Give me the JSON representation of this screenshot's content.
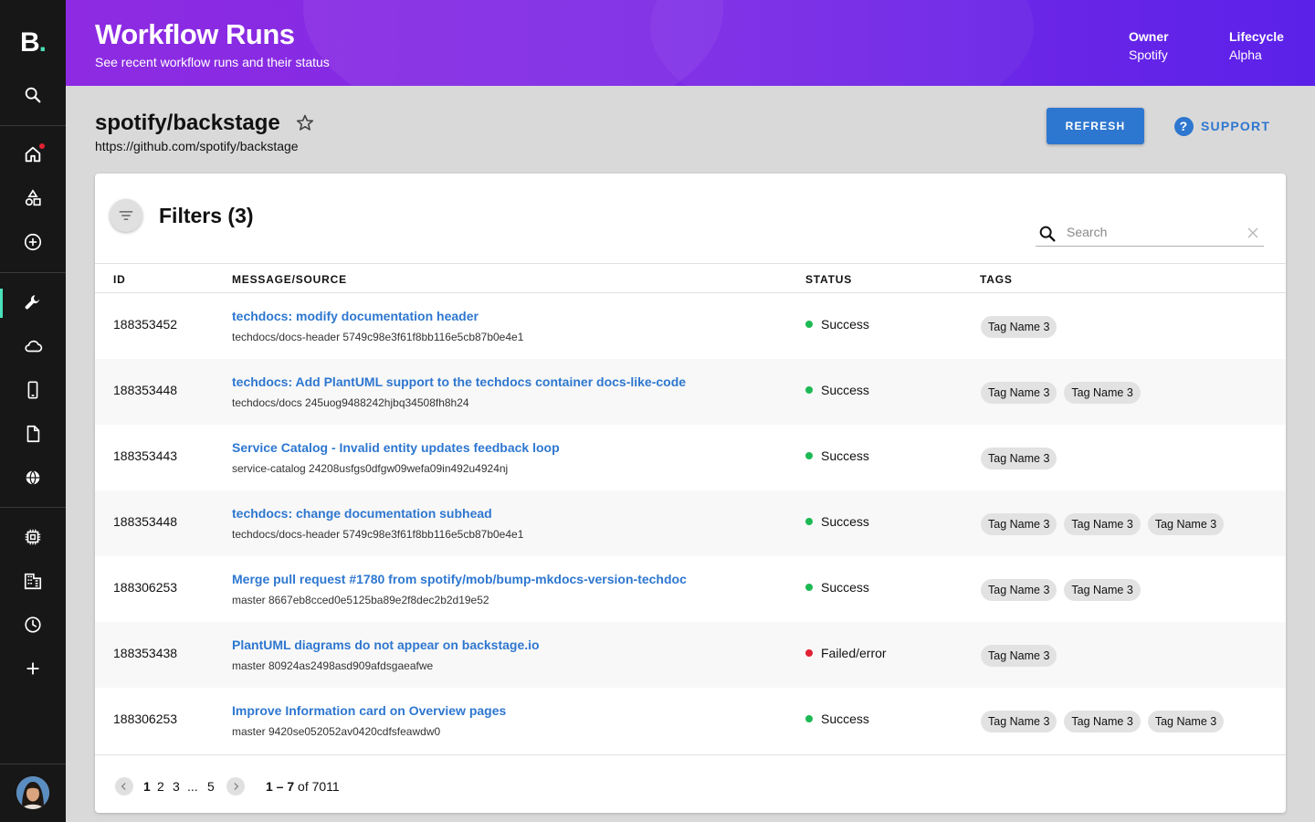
{
  "sidebar": {
    "logo_letter": "B",
    "logo_dot": ".",
    "items": [
      {
        "name": "search-icon"
      },
      {
        "name": "home-icon"
      },
      {
        "name": "catalog-icon"
      },
      {
        "name": "create-icon"
      },
      {
        "name": "tools-icon"
      },
      {
        "name": "cloud-icon"
      },
      {
        "name": "mobile-icon"
      },
      {
        "name": "docs-icon"
      },
      {
        "name": "globe-icon"
      },
      {
        "name": "chip-icon"
      },
      {
        "name": "building-icon"
      },
      {
        "name": "history-icon"
      },
      {
        "name": "add-icon"
      }
    ],
    "accent_color": "#49e0ba"
  },
  "header": {
    "title": "Workflow Runs",
    "subtitle": "See recent workflow runs and their status",
    "owner_label": "Owner",
    "owner_value": "Spotify",
    "lifecycle_label": "Lifecycle",
    "lifecycle_value": "Alpha"
  },
  "repo": {
    "title": "spotify/backstage",
    "url": "https://github.com/spotify/backstage"
  },
  "actions": {
    "refresh_label": "REFRESH",
    "support_label": "SUPPORT",
    "support_glyph": "?"
  },
  "filters": {
    "title": "Filters (3)",
    "search_placeholder": "Search"
  },
  "table": {
    "columns": [
      "ID",
      "MESSAGE/SOURCE",
      "STATUS",
      "TAGS"
    ],
    "rows": [
      {
        "id": "188353452",
        "message": "techdocs: modify documentation header",
        "source": "techdocs/docs-header 5749c98e3f61f8bb116e5cb87b0e4e1",
        "status": "Success",
        "tags": [
          "Tag Name 3"
        ]
      },
      {
        "id": "188353448",
        "message": "techdocs: Add PlantUML support to the techdocs container docs-like-code",
        "source": "techdocs/docs 245uog9488242hjbq34508fh8h24",
        "status": "Success",
        "tags": [
          "Tag Name 3",
          "Tag Name 3"
        ]
      },
      {
        "id": "188353443",
        "message": "Service Catalog - Invalid entity updates feedback loop",
        "source": "service-catalog 24208usfgs0dfgw09wefa09in492u4924nj",
        "status": "Success",
        "tags": [
          "Tag Name 3"
        ]
      },
      {
        "id": "188353448",
        "message": "techdocs: change documentation subhead",
        "source": "techdocs/docs-header 5749c98e3f61f8bb116e5cb87b0e4e1",
        "status": "Success",
        "tags": [
          "Tag Name 3",
          "Tag Name 3",
          "Tag Name 3"
        ]
      },
      {
        "id": "188306253",
        "message": "Merge pull request #1780 from spotify/mob/bump-mkdocs-version-techdoc",
        "source": "master 8667eb8cced0e5125ba89e2f8dec2b2d19e52",
        "status": "Success",
        "tags": [
          "Tag Name 3",
          "Tag Name 3"
        ]
      },
      {
        "id": "188353438",
        "message": "PlantUML diagrams do not appear on backstage.io",
        "source": "master 80924as2498asd909afdsgaeafwe",
        "status": "Failed/error",
        "tags": [
          "Tag Name 3"
        ]
      },
      {
        "id": "188306253",
        "message": "Improve Information card on Overview pages",
        "source": "master 9420se052052av0420cdfsfeawdw0",
        "status": "Success",
        "tags": [
          "Tag Name 3",
          "Tag Name 3",
          "Tag Name 3"
        ]
      }
    ],
    "status_colors": {
      "Success": "#1db954",
      "Failed/error": "#e22134"
    }
  },
  "pagination": {
    "pages": [
      "1",
      "2",
      "3",
      "...",
      "5"
    ],
    "current_page": "1",
    "range": "1 – 7",
    "of_label": "of",
    "total": "7011"
  }
}
